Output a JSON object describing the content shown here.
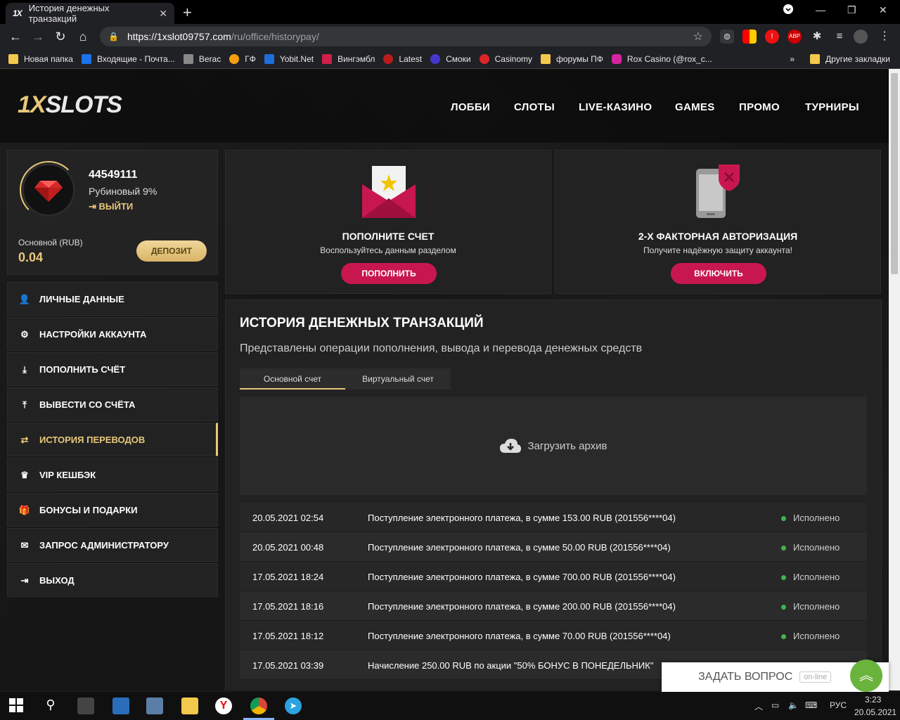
{
  "browser": {
    "tab_title": "История денежных транзакций",
    "tab_favicon": "1X",
    "url_host": "https://1xslot09757.com",
    "url_path": "/ru/office/historypay/"
  },
  "bookmarks": [
    {
      "label": "Новая папка",
      "icon": "folder-icon",
      "color": "#f2c94c"
    },
    {
      "label": "Входящие - Почта...",
      "icon": "mail-icon",
      "color": "#1a73e8"
    },
    {
      "label": "Berac",
      "icon": "berac-icon",
      "color": "#888888"
    },
    {
      "label": "ГФ",
      "icon": "gf-icon",
      "color": "#f59e0b"
    },
    {
      "label": "Yobit.Net",
      "icon": "yobit-icon",
      "color": "#1e6fd9"
    },
    {
      "label": "Вингэмбл",
      "icon": "wingamble-icon",
      "color": "#d0204a"
    },
    {
      "label": "Latest",
      "icon": "latest-icon",
      "color": "#b91c1c"
    },
    {
      "label": "Смоки",
      "icon": "smoky-icon",
      "color": "#4338ca"
    },
    {
      "label": "Casinomy",
      "icon": "casinomy-icon",
      "color": "#dc2626"
    },
    {
      "label": "форумы ПФ",
      "icon": "folder-icon",
      "color": "#f2c94c"
    },
    {
      "label": "Rox Casino (@rox_c...",
      "icon": "instagram-icon",
      "color": "#d6249f"
    }
  ],
  "other_bookmarks": "Другие закладки",
  "site": {
    "logo": {
      "one": "1X",
      "rest": "SLOTS"
    },
    "nav": [
      "ЛОББИ",
      "СЛОТЫ",
      "LIVE-КАЗИНО",
      "GAMES",
      "ПРОМО",
      "ТУРНИРЫ"
    ]
  },
  "profile": {
    "id": "44549111",
    "rank": "Рубиновый 9%",
    "logout": "ВЫЙТИ",
    "balance_label": "Основной (RUB)",
    "balance_value": "0.04",
    "deposit_button": "ДЕПОЗИТ"
  },
  "menu": [
    {
      "label": "ЛИЧНЫЕ ДАННЫЕ",
      "icon": "user-icon",
      "glyph": "👤",
      "active": false
    },
    {
      "label": "НАСТРОЙКИ АККАУНТА",
      "icon": "gears-icon",
      "glyph": "⚙",
      "active": false
    },
    {
      "label": "ПОПОЛНИТЬ СЧЁТ",
      "icon": "download-icon",
      "glyph": "⤓",
      "active": false
    },
    {
      "label": "ВЫВЕСТИ СО СЧЁТА",
      "icon": "upload-icon",
      "glyph": "⤒",
      "active": false
    },
    {
      "label": "ИСТОРИЯ ПЕРЕВОДОВ",
      "icon": "transfer-icon",
      "glyph": "⇄",
      "active": true
    },
    {
      "label": "VIP КЕШБЭК",
      "icon": "crown-icon",
      "glyph": "♛",
      "active": false
    },
    {
      "label": "БОНУСЫ И ПОДАРКИ",
      "icon": "gift-icon",
      "glyph": "🎁",
      "active": false
    },
    {
      "label": "ЗАПРОС АДМИНИСТРАТОРУ",
      "icon": "envelope-icon",
      "glyph": "✉",
      "active": false
    },
    {
      "label": "ВЫХОД",
      "icon": "exit-icon",
      "glyph": "⇥",
      "active": false
    }
  ],
  "promo_deposit": {
    "title": "ПОПОЛНИТЕ СЧЕТ",
    "subtitle": "Воспользуйтесь данным разделом",
    "button": "ПОПОЛНИТЬ"
  },
  "promo_2fa": {
    "title": "2-Х ФАКТОРНАЯ АВТОРИЗАЦИЯ",
    "subtitle": "Получите надёжную защиту аккаунта!",
    "button": "ВКЛЮЧИТЬ"
  },
  "history": {
    "title": "ИСТОРИЯ ДЕНЕЖНЫХ ТРАНЗАКЦИЙ",
    "subtitle": "Представлены операции пополнения, вывода и перевода денежных средств",
    "tabs": [
      "Основной счет",
      "Виртуальный счет"
    ],
    "archive_label": "Загрузить архив",
    "rows": [
      {
        "date": "20.05.2021 02:54",
        "desc": "Поступление электронного платежа, в сумме 153.00 RUB (201556****04)",
        "status": "Исполнено"
      },
      {
        "date": "20.05.2021 00:48",
        "desc": "Поступление электронного платежа, в сумме 50.00 RUB (201556****04)",
        "status": "Исполнено"
      },
      {
        "date": "17.05.2021 18:24",
        "desc": "Поступление электронного платежа, в сумме 700.00 RUB (201556****04)",
        "status": "Исполнено"
      },
      {
        "date": "17.05.2021 18:16",
        "desc": "Поступление электронного платежа, в сумме 200.00 RUB (201556****04)",
        "status": "Исполнено"
      },
      {
        "date": "17.05.2021 18:12",
        "desc": "Поступление электронного платежа, в сумме 70.00 RUB (201556****04)",
        "status": "Исполнено"
      },
      {
        "date": "17.05.2021 03:39",
        "desc": "Начисление 250.00 RUB по акции \"50% БОНУС В ПОНЕДЕЛЬНИК\"",
        "status": ""
      }
    ],
    "status_color": "#3fb54a"
  },
  "chat": {
    "label": "ЗАДАТЬ ВОПРОС",
    "badge": "on-line"
  },
  "taskbar": {
    "lang": "РУС",
    "time": "3:23",
    "date": "20.05.2021"
  },
  "colors": {
    "accent_gold": "#e8c77a",
    "accent_red": "#c8174f",
    "chat_green": "#6ab43e"
  }
}
